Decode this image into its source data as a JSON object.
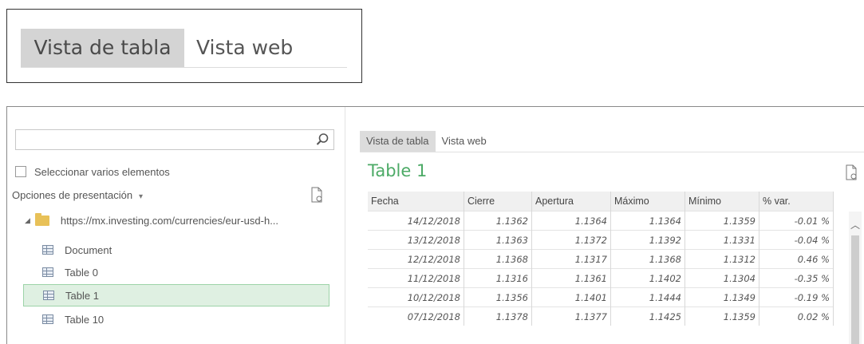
{
  "zoomed_tabs": [
    "Vista de tabla",
    "Vista web"
  ],
  "navigator": {
    "search": {
      "value": "",
      "placeholder": ""
    },
    "select_multiple_label": "Seleccionar varios elementos",
    "display_options_label": "Opciones de presentación",
    "source_url": "https://mx.investing.com/currencies/eur-usd-h...",
    "items": [
      {
        "label": "Document",
        "selected": false
      },
      {
        "label": "Table 0",
        "selected": false
      },
      {
        "label": "Table 1",
        "selected": true
      },
      {
        "label": "Table 10",
        "selected": false
      }
    ]
  },
  "preview": {
    "tabs": [
      "Vista de tabla",
      "Vista web"
    ],
    "active_tab": "Vista de tabla",
    "title": "Table 1",
    "columns": [
      "Fecha",
      "Cierre",
      "Apertura",
      "Máximo",
      "Mínimo",
      "% var."
    ],
    "rows": [
      [
        "14/12/2018",
        "1.1362",
        "1.1364",
        "1.1364",
        "1.1359",
        "-0.01 %"
      ],
      [
        "13/12/2018",
        "1.1363",
        "1.1372",
        "1.1392",
        "1.1331",
        "-0.04 %"
      ],
      [
        "12/12/2018",
        "1.1368",
        "1.1317",
        "1.1368",
        "1.1312",
        "0.46 %"
      ],
      [
        "11/12/2018",
        "1.1316",
        "1.1361",
        "1.1402",
        "1.1304",
        "-0.35 %"
      ],
      [
        "10/12/2018",
        "1.1356",
        "1.1401",
        "1.1444",
        "1.1349",
        "-0.19 %"
      ],
      [
        "07/12/2018",
        "1.1378",
        "1.1377",
        "1.1425",
        "1.1359",
        "0.02 %"
      ]
    ]
  },
  "colors": {
    "accent_green": "#4caa66",
    "selected_bg": "#dff0e2",
    "folder": "#e8c158"
  }
}
